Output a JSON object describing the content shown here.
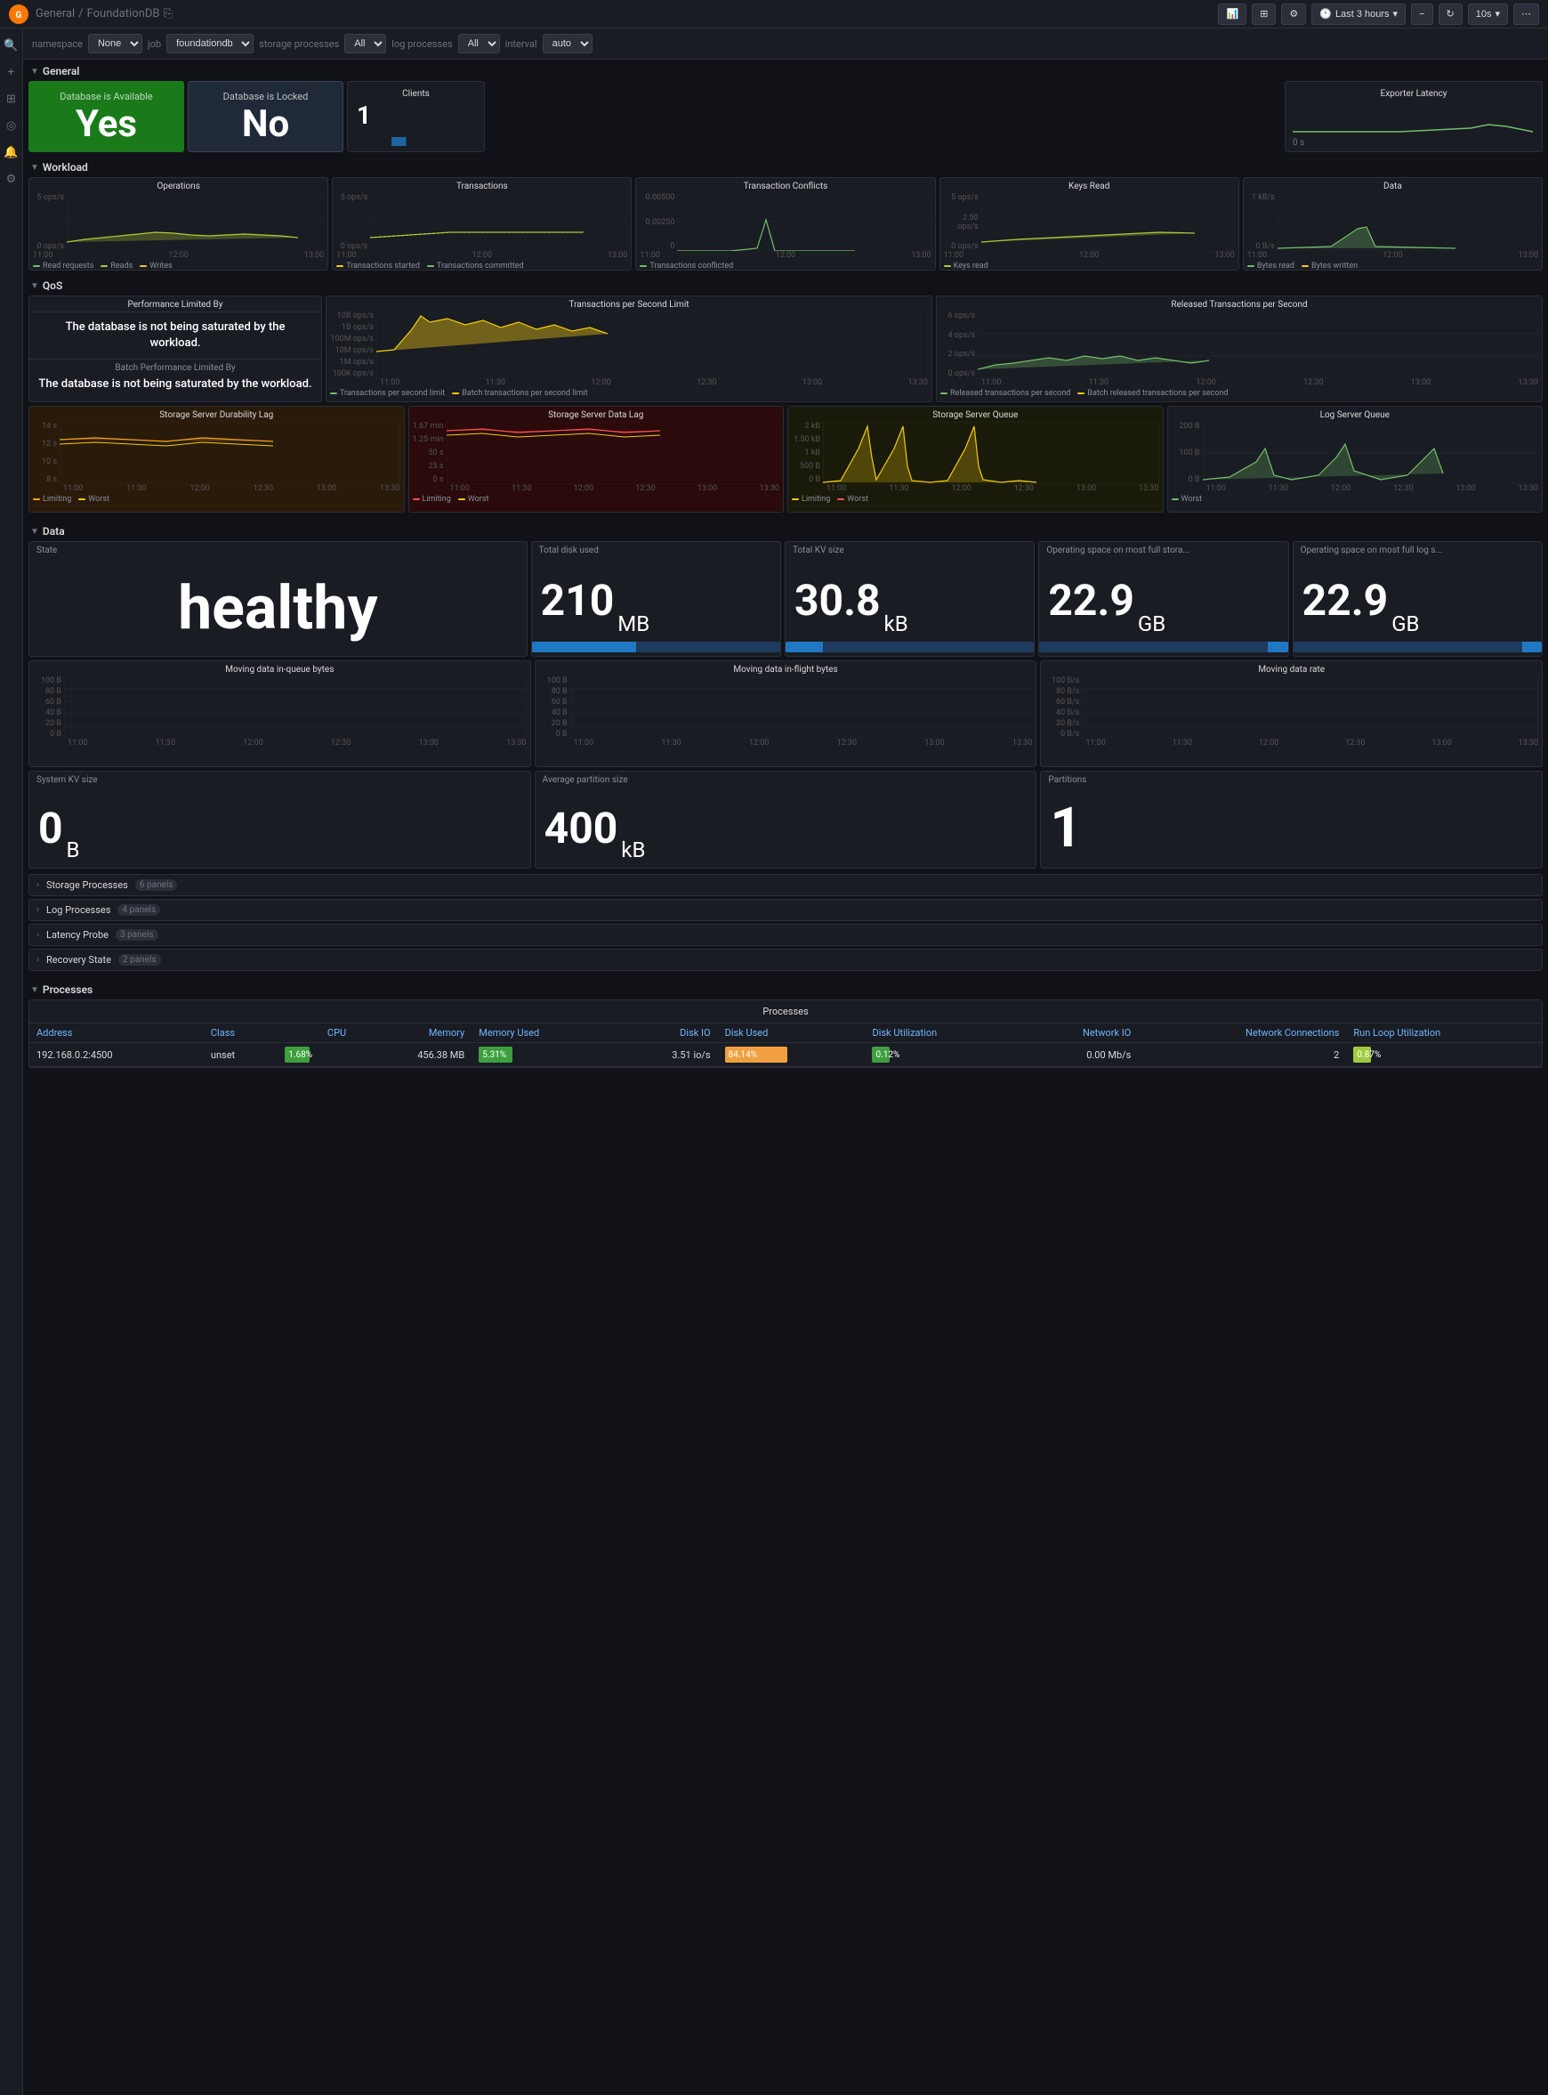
{
  "app": {
    "logo": "G",
    "breadcrumb_1": "General",
    "breadcrumb_sep": "/",
    "breadcrumb_2": "FoundationDB",
    "time_range": "Last 3 hours",
    "refresh_interval": "10s"
  },
  "filters": [
    {
      "label": "namespace",
      "value": "namespace"
    },
    {
      "label": "",
      "value": "None ▾"
    },
    {
      "label": "job",
      "value": "job"
    },
    {
      "label": "",
      "value": "foundationdb ▾"
    },
    {
      "label": "storage processes",
      "value": "storage processes"
    },
    {
      "label": "",
      "value": "All ▾"
    },
    {
      "label": "log processes",
      "value": "log processes"
    },
    {
      "label": "",
      "value": "All ▾"
    },
    {
      "label": "interval",
      "value": "interval"
    },
    {
      "label": "",
      "value": "auto ▾"
    }
  ],
  "sections": {
    "general": {
      "title": "General",
      "panels": {
        "db_available": {
          "title": "Database is Available",
          "value": "Yes"
        },
        "db_locked": {
          "title": "Database is Locked",
          "value": "No"
        },
        "clients": {
          "title": "Clients",
          "value": "1"
        },
        "exporter_latency": {
          "title": "Exporter Latency",
          "value": "0 s"
        }
      }
    },
    "workload": {
      "title": "Workload",
      "panels": {
        "operations": {
          "title": "Operations",
          "y_top": "5 ops/s",
          "y_bot": "0 ops/s",
          "legend": [
            "Read requests",
            "Reads",
            "Writes"
          ],
          "times": [
            "11:00",
            "12:00",
            "13:00"
          ]
        },
        "transactions": {
          "title": "Transactions",
          "y_top": "5 ops/s",
          "y_bot": "0 ops/s",
          "legend": [
            "Transactions started",
            "Transactions committed"
          ],
          "times": [
            "11:00",
            "12:00",
            "13:00"
          ]
        },
        "transaction_conflicts": {
          "title": "Transaction Conflicts",
          "y_top": "0.00500",
          "y_bot": "0",
          "legend": [
            "Transactions conflicted"
          ],
          "times": [
            "11:00",
            "12:00",
            "13:00"
          ]
        },
        "keys_read": {
          "title": "Keys Read",
          "y_top": "5 ops/s",
          "y_mid": "2.50 ops/s",
          "y_bot": "0 ops/s",
          "legend": [
            "Keys read"
          ],
          "times": [
            "11:00",
            "12:00",
            "13:00"
          ]
        },
        "data": {
          "title": "Data",
          "y_top": "1 kB/s",
          "y_bot": "0 B/s",
          "legend": [
            "Bytes read",
            "Bytes written"
          ],
          "times": [
            "11:00",
            "12:00",
            "13:00"
          ]
        }
      }
    },
    "qos": {
      "title": "QoS",
      "perf_limited": {
        "label": "Performance Limited By",
        "text": "The database is not being saturated by the workload."
      },
      "batch_perf_limited": {
        "label": "Batch Performance Limited By",
        "text": "The database is not being saturated by the workload."
      },
      "tps_limit": {
        "title": "Transactions per Second Limit",
        "y_labels": [
          "10B ops/s",
          "1B ops/s",
          "100M ops/s",
          "10M ops/s",
          "1M ops/s",
          "100K ops/s"
        ],
        "legend": [
          "Transactions per second limit",
          "Batch transactions per second limit"
        ],
        "times": [
          "11:00",
          "11:30",
          "12:00",
          "12:30",
          "13:00",
          "13:30"
        ]
      },
      "released_tps": {
        "title": "Released Transactions per Second",
        "y_labels": [
          "6 ops/s",
          "4 ops/s",
          "2 ops/s",
          "0 ops/s"
        ],
        "legend": [
          "Released transactions per second",
          "Batch released transactions per second"
        ],
        "times": [
          "11:00",
          "11:30",
          "12:00",
          "12:30",
          "13:00",
          "13:30"
        ]
      },
      "storage_dur_lag": {
        "title": "Storage Server Durability Lag",
        "y_labels": [
          "14 s",
          "12 s",
          "10 s",
          "8 s"
        ],
        "legend": [
          "Limiting",
          "Worst"
        ],
        "times": [
          "11:00",
          "11:30",
          "12:00",
          "12:30",
          "13:00",
          "13:30"
        ]
      },
      "storage_data_lag": {
        "title": "Storage Server Data Lag",
        "y_labels": [
          "1.67 min",
          "1.25 min",
          "50 s",
          "25 s",
          "0 s"
        ],
        "legend": [
          "Limiting",
          "Worst"
        ],
        "times": [
          "11:00",
          "11:30",
          "12:00",
          "12:30",
          "13:00",
          "13:30"
        ]
      },
      "storage_queue": {
        "title": "Storage Server Queue",
        "y_labels": [
          "2 kB",
          "1.50 kB",
          "1 kB",
          "500 B",
          "0 B"
        ],
        "legend": [
          "Limiting",
          "Worst"
        ],
        "times": [
          "11:00",
          "11:30",
          "12:00",
          "12:30",
          "13:00",
          "13:30"
        ]
      },
      "log_queue": {
        "title": "Log Server Queue",
        "y_labels": [
          "200 B",
          "100 B",
          "0 B"
        ],
        "legend": [
          "Worst"
        ],
        "times": [
          "11:00",
          "11:30",
          "12:00",
          "12:30",
          "13:00",
          "13:30"
        ]
      }
    },
    "data": {
      "title": "Data",
      "state": {
        "label": "State",
        "value": "healthy"
      },
      "total_disk": {
        "label": "Total disk used",
        "value": "210",
        "unit": "MB"
      },
      "total_kv": {
        "label": "Total KV size",
        "value": "30.8",
        "unit": "kB"
      },
      "os_full_store": {
        "label": "Operating space on most full stora...",
        "value": "22.9",
        "unit": "GB"
      },
      "os_full_log": {
        "label": "Operating space on most full log s...",
        "value": "22.9",
        "unit": "GB"
      },
      "moving_inqueue": {
        "title": "Moving data in-queue bytes",
        "y_top": "100 B",
        "y_labels": [
          "100 B",
          "80 B",
          "60 B",
          "40 B",
          "20 B",
          "0 B"
        ],
        "times": [
          "11:00",
          "11:30",
          "12:00",
          "12:30",
          "13:00",
          "13:30"
        ]
      },
      "moving_inflight": {
        "title": "Moving data in-flight bytes",
        "y_labels": [
          "100 B",
          "80 B",
          "60 B",
          "40 B",
          "20 B",
          "0 B"
        ],
        "times": [
          "11:00",
          "11:30",
          "12:00",
          "12:30",
          "13:00",
          "13:30"
        ]
      },
      "moving_rate": {
        "title": "Moving data rate",
        "y_labels": [
          "100 B/s",
          "80 B/s",
          "60 B/s",
          "40 B/s",
          "20 B/s",
          "0 B/s"
        ],
        "times": [
          "11:00",
          "11:30",
          "12:00",
          "12:30",
          "13:00",
          "13:30"
        ]
      },
      "system_kv": {
        "label": "System KV size",
        "value": "0",
        "unit": "B"
      },
      "avg_partition": {
        "label": "Average partition size",
        "value": "400",
        "unit": "kB"
      },
      "partitions": {
        "label": "Partitions",
        "value": "1"
      }
    },
    "storage_processes": {
      "title": "Storage Processes",
      "badge": "6 panels"
    },
    "log_processes": {
      "title": "Log Processes",
      "badge": "4 panels"
    },
    "latency_probe": {
      "title": "Latency Probe",
      "badge": "3 panels"
    },
    "recovery_state": {
      "title": "Recovery State",
      "badge": "2 panels"
    },
    "processes": {
      "title": "Processes",
      "table": {
        "title": "Processes",
        "columns": [
          "Address",
          "Class",
          "CPU",
          "Memory",
          "Memory Used",
          "Disk IO",
          "Disk Used",
          "Disk Utilization",
          "Network IO",
          "Network Connections",
          "Run Loop Utilization"
        ],
        "rows": [
          {
            "address": "192.168.0.2:4500",
            "class": "unset",
            "cpu": "1.68%",
            "memory": "456.38 MB",
            "memory_used": "5.31%",
            "disk_io": "3.51 io/s",
            "disk_used": "84.14%",
            "disk_util": "0.12%",
            "network_io": "0.00 Mb/s",
            "network_conn": "2",
            "run_loop": "0.87%"
          }
        ]
      }
    }
  }
}
